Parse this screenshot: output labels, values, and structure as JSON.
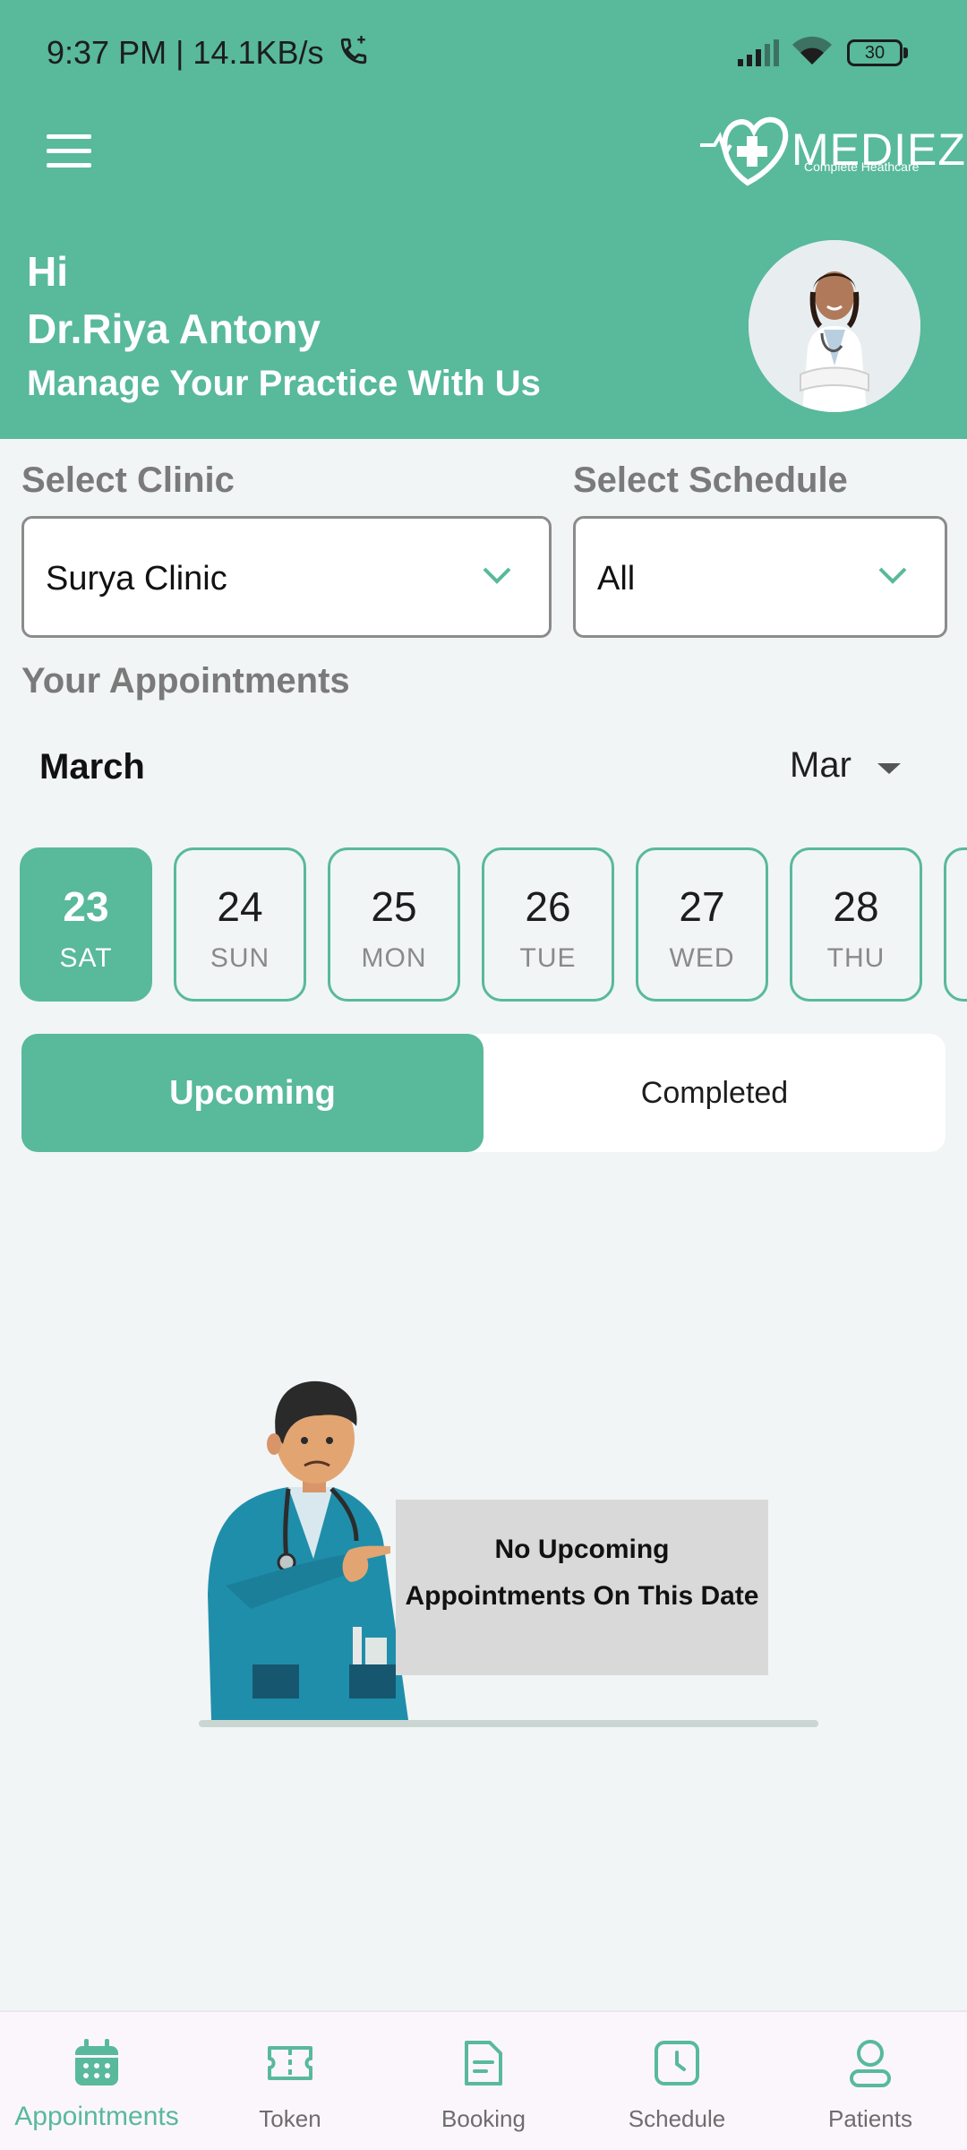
{
  "status_bar": {
    "time_speed": "9:37 PM | 14.1KB/s",
    "battery": "30"
  },
  "header": {
    "logo_name": "MEDIEZY",
    "logo_tagline": "Complete Heathcare",
    "greeting": "Hi",
    "doctor_name": "Dr.Riya Antony",
    "subtitle": "Manage Your Practice With Us"
  },
  "filters": {
    "clinic_label": "Select Clinic",
    "clinic_value": "Surya Clinic",
    "schedule_label": "Select Schedule",
    "schedule_value": "All"
  },
  "appointments": {
    "section_title": "Your Appointments",
    "month_title": "March",
    "month_dropdown": "Mar",
    "dates": [
      {
        "num": "23",
        "day": "SAT",
        "active": true
      },
      {
        "num": "24",
        "day": "SUN",
        "active": false
      },
      {
        "num": "25",
        "day": "MON",
        "active": false
      },
      {
        "num": "26",
        "day": "TUE",
        "active": false
      },
      {
        "num": "27",
        "day": "WED",
        "active": false
      },
      {
        "num": "28",
        "day": "THU",
        "active": false
      }
    ],
    "tabs": {
      "upcoming": "Upcoming",
      "completed": "Completed"
    },
    "empty_line1": "No Upcoming",
    "empty_line2": "Appointments On This Date"
  },
  "bottom_nav": [
    {
      "label": "Appointments",
      "icon": "calendar-icon",
      "active": true
    },
    {
      "label": "Token",
      "icon": "ticket-icon",
      "active": false
    },
    {
      "label": "Booking",
      "icon": "document-icon",
      "active": false
    },
    {
      "label": "Schedule",
      "icon": "clock-icon",
      "active": false
    },
    {
      "label": "Patients",
      "icon": "person-icon",
      "active": false
    }
  ],
  "colors": {
    "brand": "#58b99b",
    "background": "#f1f5f5",
    "nav_inactive": "#6d6d6d"
  }
}
